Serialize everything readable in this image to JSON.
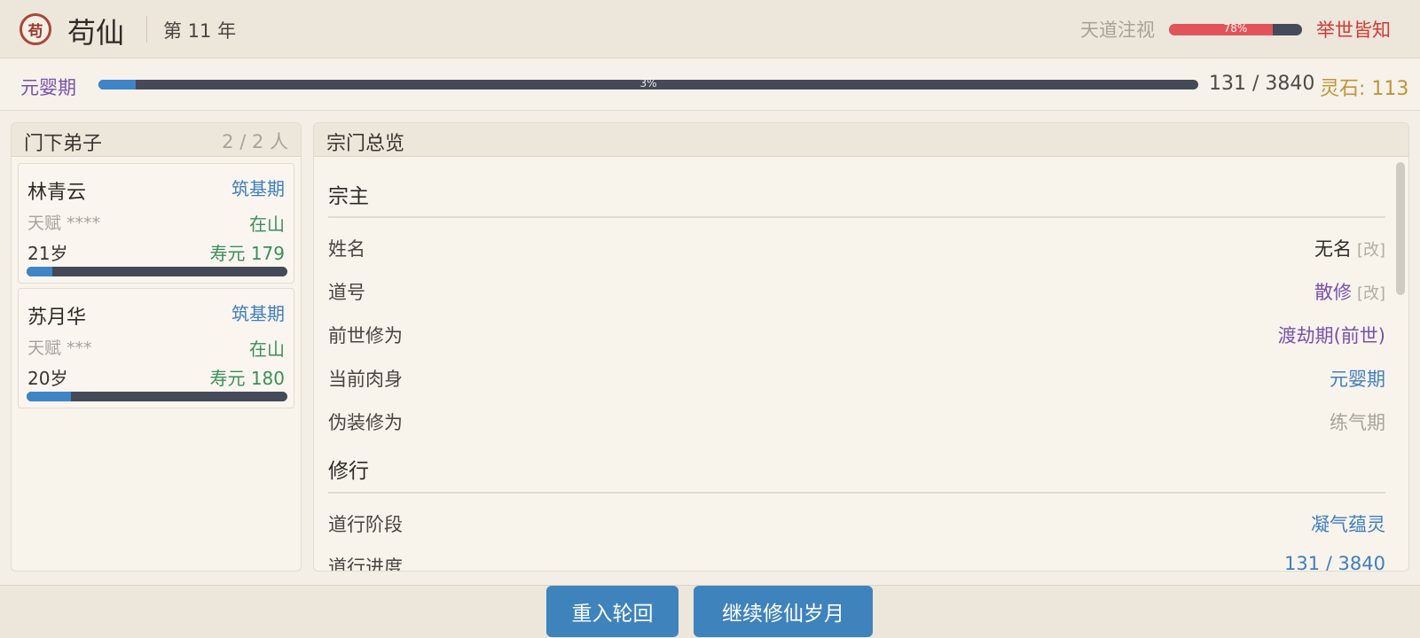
{
  "header": {
    "seal_char": "苟",
    "title": "苟仙",
    "year": "第 11 年",
    "heaven_label": "天道注视",
    "heaven_pct": "78%",
    "heaven_value": 0.78,
    "fame": "举世皆知",
    "colors": {
      "heaven_fill": "#e0545a",
      "fame": "#d23a36"
    }
  },
  "realm": {
    "name": "元婴期",
    "pct": "3%",
    "progress": 0.034,
    "count": "131 / 3840",
    "stones": "灵石: 113"
  },
  "disciples": {
    "title": "门下弟子",
    "count": "2 / 2 人",
    "items": [
      {
        "name": "林青云",
        "realm": "筑基期",
        "talent": "天赋 ****",
        "status": "在山",
        "age": "21岁",
        "life": "寿元 179",
        "progress": 0.1
      },
      {
        "name": "苏月华",
        "realm": "筑基期",
        "talent": "天赋 ***",
        "status": "在山",
        "age": "20岁",
        "life": "寿元 180",
        "progress": 0.17
      }
    ]
  },
  "overview": {
    "title": "宗门总览",
    "leader_section": "宗主",
    "rows": [
      {
        "label": "姓名",
        "value": "无名",
        "edit": "[改]",
        "color": "#2e2a26"
      },
      {
        "label": "道号",
        "value": "散修",
        "edit": "[改]",
        "color": "#7a4fb0"
      },
      {
        "label": "前世修为",
        "value": "渡劫期(前世)",
        "color": "#7a4fb0"
      },
      {
        "label": "当前肉身",
        "value": "元婴期",
        "color": "#3f7ec2"
      },
      {
        "label": "伪装修为",
        "value": "练气期",
        "color": "#a8a399"
      }
    ],
    "cultivation_section": "修行",
    "rows2": [
      {
        "label": "道行阶段",
        "value": "凝气蕴灵",
        "color": "#3f7ec2"
      },
      {
        "label": "道行进度",
        "value": "131 / 3840",
        "color": "#3f7ec2"
      }
    ]
  },
  "buttons": {
    "reincarnate": "重入轮回",
    "continue": "继续修仙岁月"
  }
}
